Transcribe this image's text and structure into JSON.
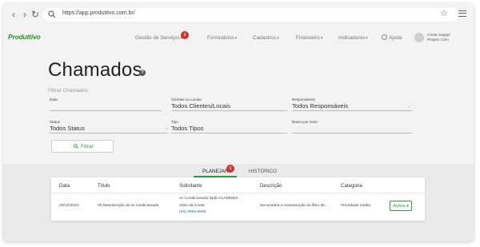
{
  "browser": {
    "url": "https://app.produttivo.com.br/"
  },
  "app": {
    "logo": "Produttivo",
    "nav": [
      {
        "label": "Gestão de Serviços"
      },
      {
        "label": "Formulários"
      },
      {
        "label": "Cadastros"
      },
      {
        "label": "Financeiro"
      },
      {
        "label": "Indicadores"
      }
    ],
    "nav_badge": "1",
    "help_label": "Ajuda",
    "user_name": "Cíntia Saygel",
    "user_project": "Projeto CSH"
  },
  "page": {
    "title": "Chamados",
    "filter_heading": "Filtrar Chamados",
    "filters": {
      "data": {
        "label": "Data",
        "value": ""
      },
      "clientes": {
        "label": "Clientes ou Locais",
        "value": "Todos Clientes/Locais"
      },
      "responsaveis": {
        "label": "Responsáveis",
        "value": "Todos Responsáveis"
      },
      "status": {
        "label": "Status",
        "value": "Todos Status"
      },
      "tipo": {
        "label": "Tipo",
        "value": "Todos Tipos"
      },
      "busca": {
        "label": "Busca por texto",
        "value": ""
      }
    },
    "filter_button": "Filtrar"
  },
  "tabs": [
    {
      "label": "PLANEJAR",
      "active": true,
      "badge": "1"
    },
    {
      "label": "HISTÓRICO",
      "active": false
    }
  ],
  "table": {
    "columns": [
      "Data",
      "Título",
      "Solicitante",
      "Descrição",
      "Categoria"
    ],
    "rows": [
      {
        "data": "20/12/2023",
        "titulo": "#5 Manutenção do ar condicionado",
        "solicitante_line1": "Ar-Condicionado Split ACADEMIA",
        "solicitante_line2": "João da Costa",
        "solicitante_phone": "(99) 9999-9999",
        "descricao": "Necessária a manutenção do filtro de...",
        "categoria": "Prioridade média",
        "action": "Ações"
      }
    ]
  },
  "colors": {
    "brand_green": "#2e9d3d",
    "badge_red": "#d32f2f"
  }
}
